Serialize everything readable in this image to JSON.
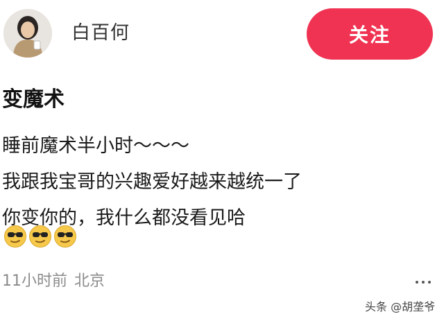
{
  "header": {
    "username": "白百何",
    "follow_label": "关注"
  },
  "post": {
    "title": "变魔术",
    "lines": [
      "睡前魔术半小时～～～",
      "我跟我宝哥的兴趣爱好越来越统一了",
      "你变你的，我什么都没看见哈"
    ],
    "emojis": [
      "sunglasses-emoji",
      "sunglasses-emoji",
      "sunglasses-emoji"
    ]
  },
  "meta": {
    "time": "11小时前",
    "location": "北京"
  },
  "watermark": "头条 @胡垄爷",
  "colors": {
    "accent": "#f03352",
    "meta_text": "#8a8a8a"
  }
}
